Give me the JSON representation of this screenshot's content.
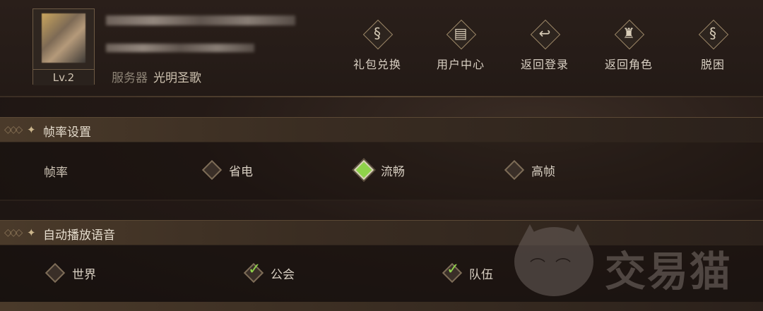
{
  "profile": {
    "level": "Lv.2",
    "server_key": "服务器",
    "server_value": "光明圣歌"
  },
  "top_buttons": [
    {
      "label": "礼包兑换",
      "icon": "gift-code-icon",
      "glyph": "§"
    },
    {
      "label": "用户中心",
      "icon": "book-icon",
      "glyph": "▤"
    },
    {
      "label": "返回登录",
      "icon": "return-arrow-icon",
      "glyph": "↩"
    },
    {
      "label": "返回角色",
      "icon": "helmet-icon",
      "glyph": "♜"
    },
    {
      "label": "脱困",
      "icon": "unstuck-icon",
      "glyph": "§"
    }
  ],
  "sections": {
    "framerate": {
      "title": "帧率设置",
      "row_label": "帧率",
      "options": [
        {
          "label": "省电",
          "selected": false
        },
        {
          "label": "流畅",
          "selected": true
        },
        {
          "label": "高帧",
          "selected": false
        }
      ]
    },
    "voice": {
      "title": "自动播放语音",
      "options": [
        {
          "label": "世界",
          "checked": false
        },
        {
          "label": "公会",
          "checked": true
        },
        {
          "label": "队伍",
          "checked": true
        }
      ]
    }
  },
  "watermark": {
    "text": "交易猫"
  },
  "colors": {
    "accent_green": "#8fd24a",
    "gold_border": "#9a8566"
  }
}
